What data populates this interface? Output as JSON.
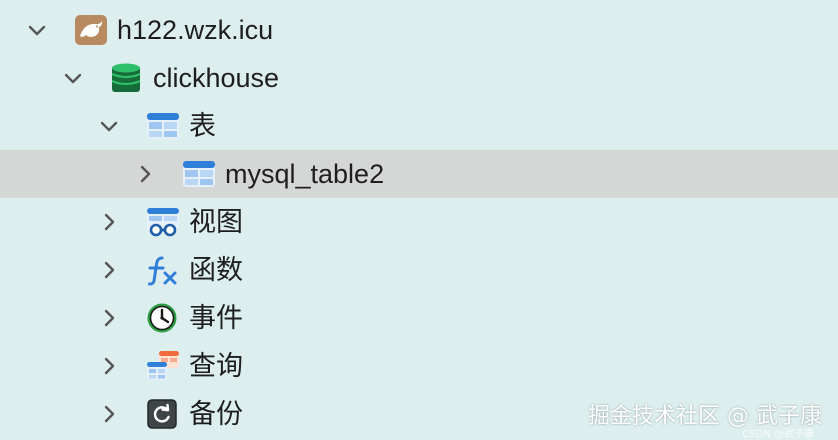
{
  "tree": {
    "server": {
      "label": "h122.wzk.icu",
      "icon": "mariadb-seal-icon",
      "expanded": true
    },
    "database": {
      "label": "clickhouse",
      "icon": "database-icon",
      "expanded": true
    },
    "tables_group": {
      "label": "表",
      "icon": "table-icon",
      "expanded": true
    },
    "table_item": {
      "label": "mysql_table2",
      "icon": "table-icon",
      "selected": true
    },
    "groups": [
      {
        "label": "视图",
        "icon": "view-icon"
      },
      {
        "label": "函数",
        "icon": "function-icon"
      },
      {
        "label": "事件",
        "icon": "clock-icon"
      },
      {
        "label": "查询",
        "icon": "query-icon"
      },
      {
        "label": "备份",
        "icon": "backup-icon"
      }
    ]
  },
  "watermark": {
    "text": "掘金技术社区 @ 武子康",
    "sub": "CSDN @武子康"
  },
  "colors": {
    "background": "#ddeeee",
    "selected_row": "#d5d7d7",
    "table_blue": "#2f7fd8",
    "db_green": "#1f9a52",
    "function_blue": "#2f7fd8",
    "clock_green": "#2e9e44",
    "query_orange": "#f06a3c"
  }
}
